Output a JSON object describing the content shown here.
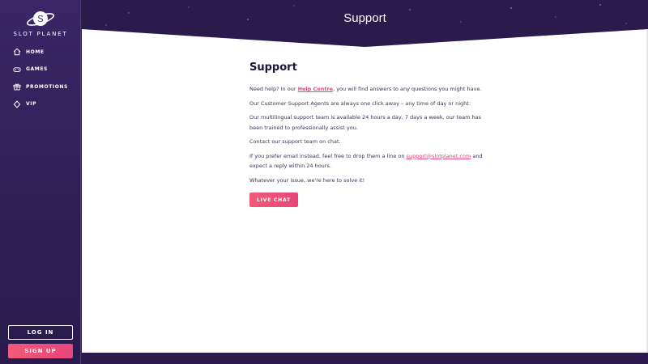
{
  "brand": {
    "name": "SLOT PLANET"
  },
  "sidebar": {
    "items": [
      {
        "label": "HOME",
        "icon": "home-icon"
      },
      {
        "label": "GAMES",
        "icon": "gamepad-icon"
      },
      {
        "label": "PROMOTIONS",
        "icon": "gift-icon"
      },
      {
        "label": "VIP",
        "icon": "diamond-icon"
      }
    ],
    "login_label": "LOG IN",
    "signup_label": "SIGN UP"
  },
  "header": {
    "title": "Support"
  },
  "article": {
    "heading": "Support",
    "p1_before": "Need help? In our ",
    "p1_link": "Help Centre",
    "p1_after": ", you will find answers to any questions you might have.",
    "p2": "Our Customer Support Agents are always one click away – any time of day or night.",
    "p3": "Our multilingual support team is available 24 hours a day, 7 days a week, our team has been trained to professionally assist you.",
    "p4": "Contact our support team on chat.",
    "p5_before": "If you prefer email instead, feel free to drop them a line on ",
    "p5_link": "support@slotplanet.com",
    "p5_after": " and expect a reply within 24 hours.",
    "p6": "Whatever your issue, we're here to solve it!",
    "chat_label": "LIVE CHAT"
  },
  "colors": {
    "accent": "#e8467a",
    "sidebar_bg": "#3a2666",
    "header_bg": "#2b1b4d",
    "heading_text": "#1f1440"
  }
}
